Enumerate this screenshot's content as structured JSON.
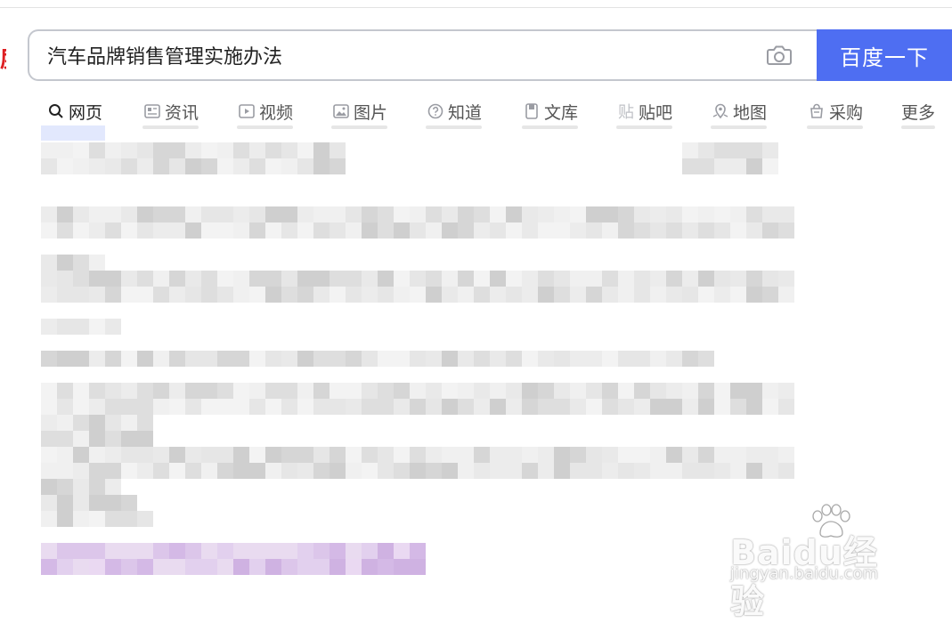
{
  "search": {
    "query": "汽车品牌销售管理实施办法",
    "button_label": "百度一下"
  },
  "tabs": [
    {
      "label": "网页",
      "icon": "search-icon",
      "active": true
    },
    {
      "label": "资讯",
      "icon": "news-icon",
      "active": false
    },
    {
      "label": "视频",
      "icon": "video-icon",
      "active": false
    },
    {
      "label": "图片",
      "icon": "image-icon",
      "active": false
    },
    {
      "label": "知道",
      "icon": "question-icon",
      "active": false
    },
    {
      "label": "文库",
      "icon": "doc-icon",
      "active": false
    },
    {
      "label": "贴吧",
      "icon": "tieba-icon",
      "active": false
    },
    {
      "label": "地图",
      "icon": "map-icon",
      "active": false
    },
    {
      "label": "采购",
      "icon": "shopping-icon",
      "active": false
    },
    {
      "label": "更多",
      "icon": "",
      "active": false
    }
  ],
  "watermark": {
    "brand": "Baidu经验",
    "url": "jingyan.baidu.com"
  },
  "colors": {
    "accent": "#4e6ef2",
    "brand_red": "#de1f22",
    "visited_link": "#c9a7e0"
  }
}
